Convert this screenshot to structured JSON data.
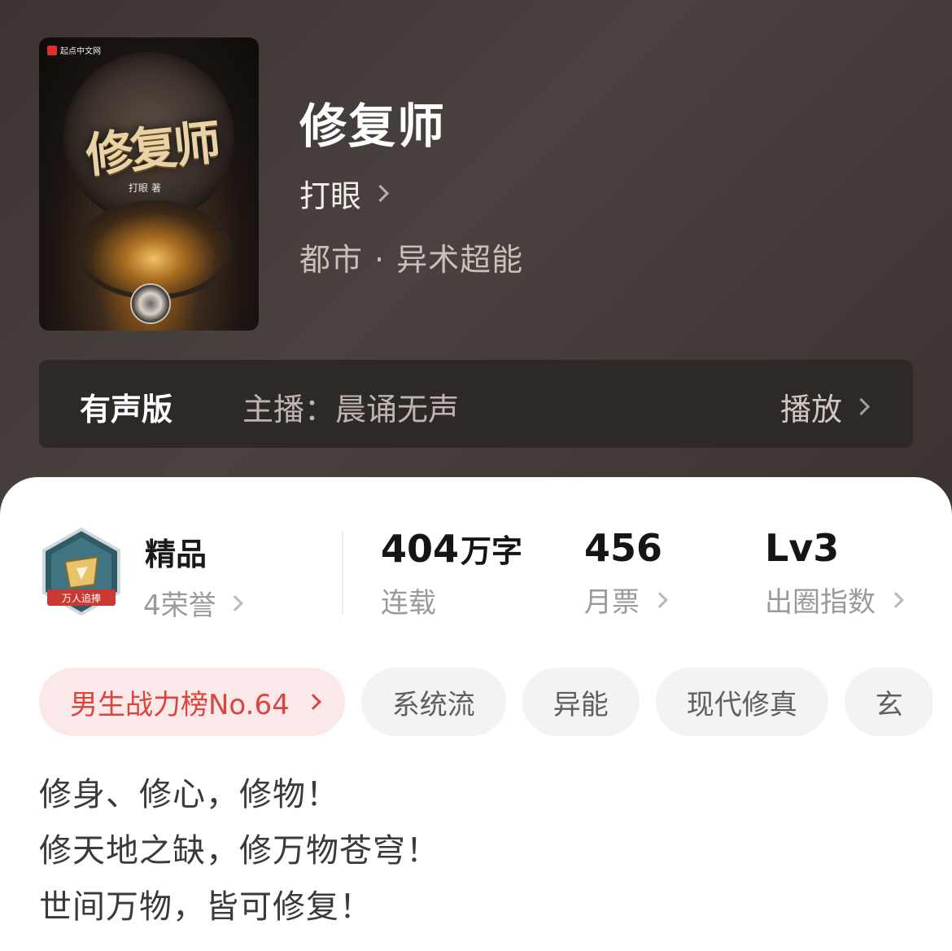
{
  "book": {
    "title": "修复师",
    "author": "打眼",
    "genre_main": "都市",
    "genre_separator": "·",
    "genre_sub": "异术超能",
    "cover": {
      "publisher": "起点中文网",
      "title_art": "修复师",
      "author_mini": "打眼 著"
    }
  },
  "audio": {
    "label": "有声版",
    "host": "主播：晨诵无声",
    "play_label": "播放"
  },
  "honor": {
    "badge_text": "万人追捧",
    "title": "精品",
    "sub": "4荣誉"
  },
  "stats": [
    {
      "value": "404",
      "unit": "万字",
      "label": "连载",
      "has_chevron": false
    },
    {
      "value": "456",
      "unit": "",
      "label": "月票",
      "has_chevron": true
    },
    {
      "value": "Lv3",
      "unit": "",
      "label": "出圈指数",
      "has_chevron": true
    }
  ],
  "tags": {
    "rank": "男生战力榜No.64",
    "items": [
      "系统流",
      "异能",
      "现代修真",
      "玄"
    ]
  },
  "description": [
    "修身、修心，修物！",
    "修天地之缺，修万物苍穹！",
    "世间万物，皆可修复！"
  ],
  "colors": {
    "hero_bg": "#3b3431",
    "audio_bar_bg": "#2e2826",
    "rank_tag_bg": "#fbe9e9",
    "rank_tag_text": "#d9453f",
    "tag_bg": "#f3f3f3"
  },
  "icons": {
    "honor_badge": "hexagon-badge-icon",
    "chevron": "chevron-right-icon"
  }
}
